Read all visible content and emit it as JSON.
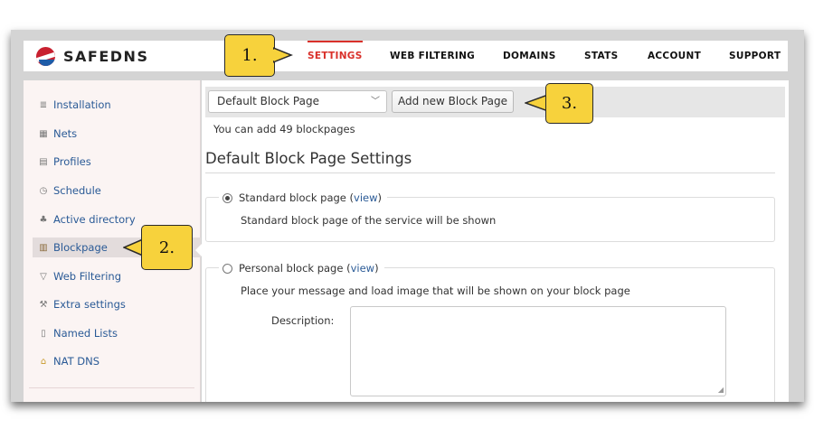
{
  "header": {
    "logo_text": "SAFEDNS",
    "nav": [
      {
        "label": "SETTINGS",
        "active": true
      },
      {
        "label": "WEB FILTERING"
      },
      {
        "label": "DOMAINS"
      },
      {
        "label": "STATS"
      },
      {
        "label": "ACCOUNT"
      },
      {
        "label": "SUPPORT"
      }
    ]
  },
  "sidebar": {
    "items": [
      {
        "label": "Installation",
        "icon": "list-icon"
      },
      {
        "label": "Nets",
        "icon": "network-icon"
      },
      {
        "label": "Profiles",
        "icon": "profiles-icon"
      },
      {
        "label": "Schedule",
        "icon": "clock-icon"
      },
      {
        "label": "Active directory",
        "icon": "directory-icon"
      },
      {
        "label": "Blockpage",
        "icon": "brick-icon",
        "active": true
      },
      {
        "label": "Web Filtering",
        "icon": "filter-icon"
      },
      {
        "label": "Extra settings",
        "icon": "wrench-icon"
      },
      {
        "label": "Named Lists",
        "icon": "document-icon"
      },
      {
        "label": "NAT DNS",
        "icon": "house-icon"
      }
    ]
  },
  "main": {
    "select_value": "Default Block Page",
    "add_button_label": "Add new Block Page",
    "count_text": "You can add 49 blockpages",
    "section_title": "Default Block Page Settings",
    "standard": {
      "label": "Standard block page",
      "view_open": "(",
      "view_link": "view",
      "view_close": ")",
      "selected": true,
      "description": "Standard block page of the service will be shown"
    },
    "personal": {
      "label": "Personal block page",
      "view_open": "(",
      "view_link": "view",
      "view_close": ")",
      "selected": false,
      "description": "Place your message and load image that will be shown on your block page",
      "description_label": "Description:"
    }
  },
  "callouts": [
    "1.",
    "2.",
    "3."
  ],
  "colors": {
    "accent": "#d9302a",
    "link": "#2a5a96",
    "callout": "#f7d23c"
  }
}
